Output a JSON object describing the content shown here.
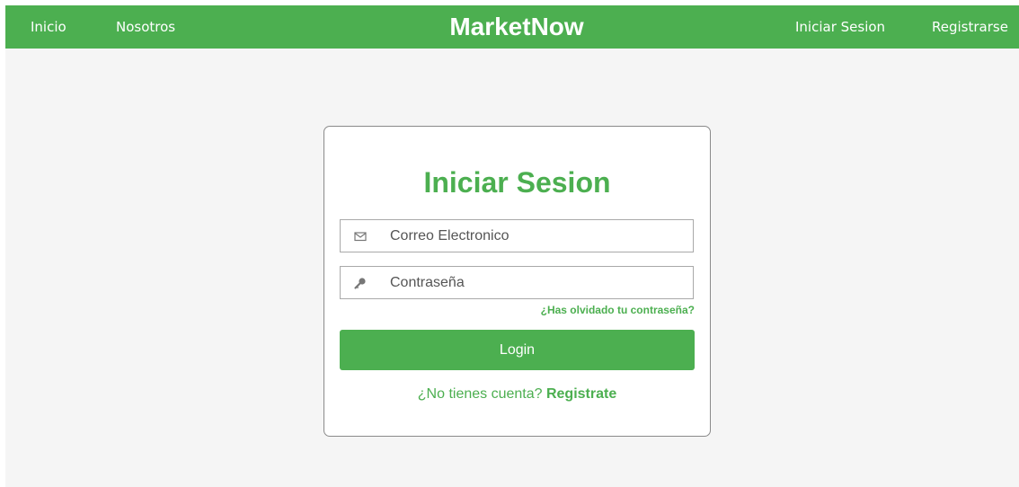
{
  "navbar": {
    "brand": "MarketNow",
    "left_links": [
      "Inicio",
      "Nosotros"
    ],
    "right_links": [
      "Iniciar Sesion",
      "Registrarse"
    ],
    "color": "#4caf50"
  },
  "login_card": {
    "title": "Iniciar Sesion",
    "email": {
      "placeholder": "Correo Electronico",
      "value": "",
      "icon": "envelope-icon"
    },
    "password": {
      "placeholder": "Contraseña",
      "value": "",
      "icon": "key-icon"
    },
    "forgot_link": "¿Has olvidado tu contraseña?",
    "submit_label": "Login",
    "signup_prompt": "¿No tienes cuenta?",
    "signup_link": "Registrate"
  },
  "colors": {
    "accent": "#4caf50",
    "background": "#f5f5f5",
    "card": "#ffffff"
  }
}
